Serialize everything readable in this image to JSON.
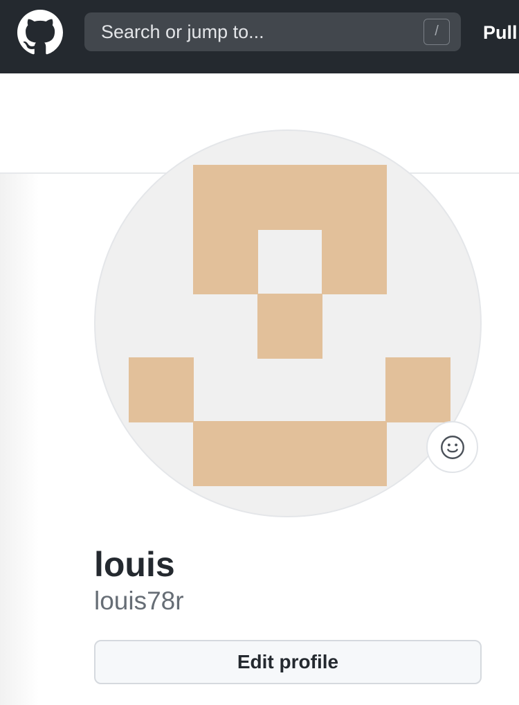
{
  "header": {
    "logo_icon": "github-mark-icon",
    "search": {
      "placeholder": "Search or jump to...",
      "value": "",
      "shortcut_key": "/"
    },
    "nav": {
      "pull_label": "Pull"
    },
    "background_color": "#24292f"
  },
  "profile": {
    "avatar": {
      "type": "identicon",
      "color": "#e2c09a",
      "background": "#f0f0f0"
    },
    "status_icon": "smiley-icon",
    "full_name": "louis",
    "username": "louis78r",
    "edit_button_label": "Edit profile"
  }
}
